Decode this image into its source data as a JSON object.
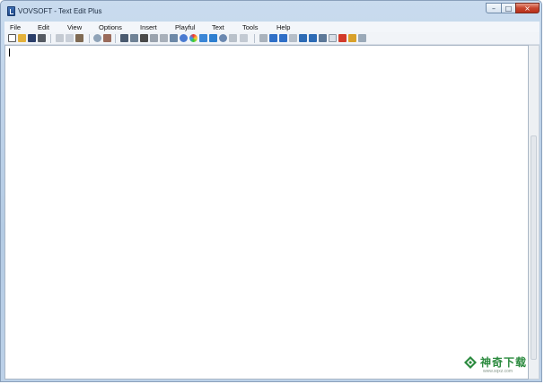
{
  "window": {
    "title": "VOVSOFT - Text Edit Plus",
    "controls": {
      "minimize_glyph": "–",
      "maximize_glyph": "□",
      "close_glyph": "×"
    }
  },
  "menu": [
    "File",
    "Edit",
    "View",
    "Options",
    "Insert",
    "Playful",
    "Text",
    "Tools",
    "Help"
  ],
  "toolbar": {
    "icons": [
      "new-file-icon",
      "open-folder-icon",
      "save-icon",
      "print-icon",
      "cut-icon",
      "copy-icon",
      "paste-icon",
      "find-icon",
      "replace-icon",
      "spell-check-icon",
      "thesaurus-icon",
      "word-count-icon",
      "lock-icon",
      "unlock-icon",
      "encode-icon",
      "color-wheel-icon",
      "brush-icon",
      "filter-icon",
      "email-icon",
      "list-icon",
      "note-icon",
      "indent-icon",
      "arrow-right-icon",
      "arrow-down-icon",
      "copy-window-icon",
      "sort-asc-icon",
      "sort-desc-icon",
      "document-icon",
      "calendar-icon",
      "tools-icon",
      "image-icon"
    ]
  },
  "editor": {
    "content": ""
  },
  "watermark": {
    "text": "神奇下载",
    "sub": "www.sqxz.com"
  },
  "colors": {
    "titlebar": "#b4cbe4",
    "close_button": "#c7462e",
    "watermark": "#2b8a3e"
  }
}
